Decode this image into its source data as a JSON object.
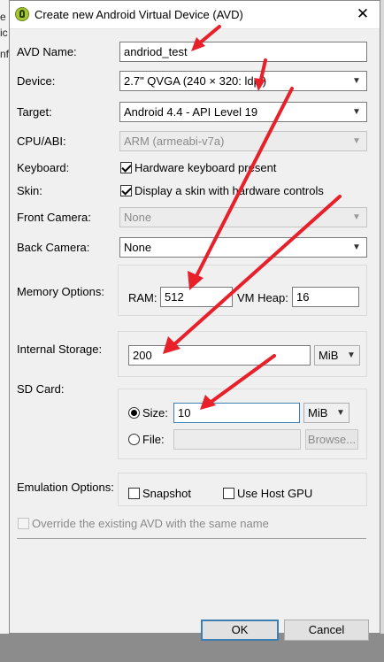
{
  "window": {
    "title": "Create new Android Virtual Device (AVD)",
    "close_glyph": "✕"
  },
  "background": {
    "fragments": [
      "e",
      "ic",
      "nf"
    ]
  },
  "form": {
    "avd_name": {
      "label": "AVD Name:",
      "value": "andriod_test"
    },
    "device": {
      "label": "Device:",
      "value": "2.7\" QVGA (240 × 320: ldpi)"
    },
    "target": {
      "label": "Target:",
      "value": "Android 4.4 - API Level 19"
    },
    "cpu_abi": {
      "label": "CPU/ABI:",
      "value": "ARM (armeabi-v7a)"
    },
    "keyboard": {
      "label": "Keyboard:",
      "checkbox_label": "Hardware keyboard present",
      "checked": true
    },
    "skin": {
      "label": "Skin:",
      "checkbox_label": "Display a skin with hardware controls",
      "checked": true
    },
    "front_camera": {
      "label": "Front Camera:",
      "value": "None"
    },
    "back_camera": {
      "label": "Back Camera:",
      "value": "None"
    },
    "memory": {
      "label": "Memory Options:",
      "ram_label": "RAM:",
      "ram_value": "512",
      "vm_heap_label": "VM Heap:",
      "vm_heap_value": "16"
    },
    "internal_storage": {
      "label": "Internal Storage:",
      "value": "200",
      "unit": "MiB"
    },
    "sd_card": {
      "label": "SD Card:",
      "size_label": "Size:",
      "size_value": "10",
      "size_unit": "MiB",
      "file_label": "File:",
      "file_value": "",
      "browse_label": "Browse..."
    },
    "emulation": {
      "label": "Emulation Options:",
      "snapshot_label": "Snapshot",
      "host_gpu_label": "Use Host GPU"
    },
    "override": {
      "label": "Override the existing AVD with the same name"
    }
  },
  "buttons": {
    "ok": "OK",
    "cancel": "Cancel"
  },
  "colors": {
    "annotation_arrow": "#e8202a",
    "focus_border": "#3c7fb1"
  }
}
